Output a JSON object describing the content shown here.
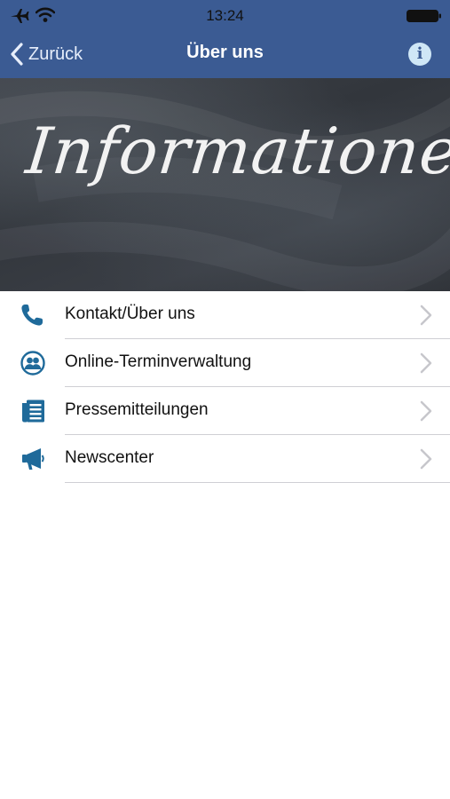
{
  "status_bar": {
    "time": "13:24",
    "airplane_icon": "airplane-icon",
    "wifi_icon": "wifi-icon",
    "battery_icon": "battery-icon"
  },
  "nav": {
    "back_label": "Zurück",
    "title": "Über uns",
    "info_icon": "info-icon"
  },
  "hero": {
    "text": "Informationen"
  },
  "menu": {
    "items": [
      {
        "label": "Kontakt/Über uns",
        "icon": "phone-icon"
      },
      {
        "label": "Online-Terminverwaltung",
        "icon": "users-icon"
      },
      {
        "label": "Pressemitteilungen",
        "icon": "document-list-icon"
      },
      {
        "label": "Newscenter",
        "icon": "megaphone-icon"
      }
    ]
  },
  "colors": {
    "nav_bar": "#3b5b93",
    "icon_accent": "#1f6a9a",
    "chevron": "#c7c7cc",
    "separator": "#cfcfd4"
  }
}
